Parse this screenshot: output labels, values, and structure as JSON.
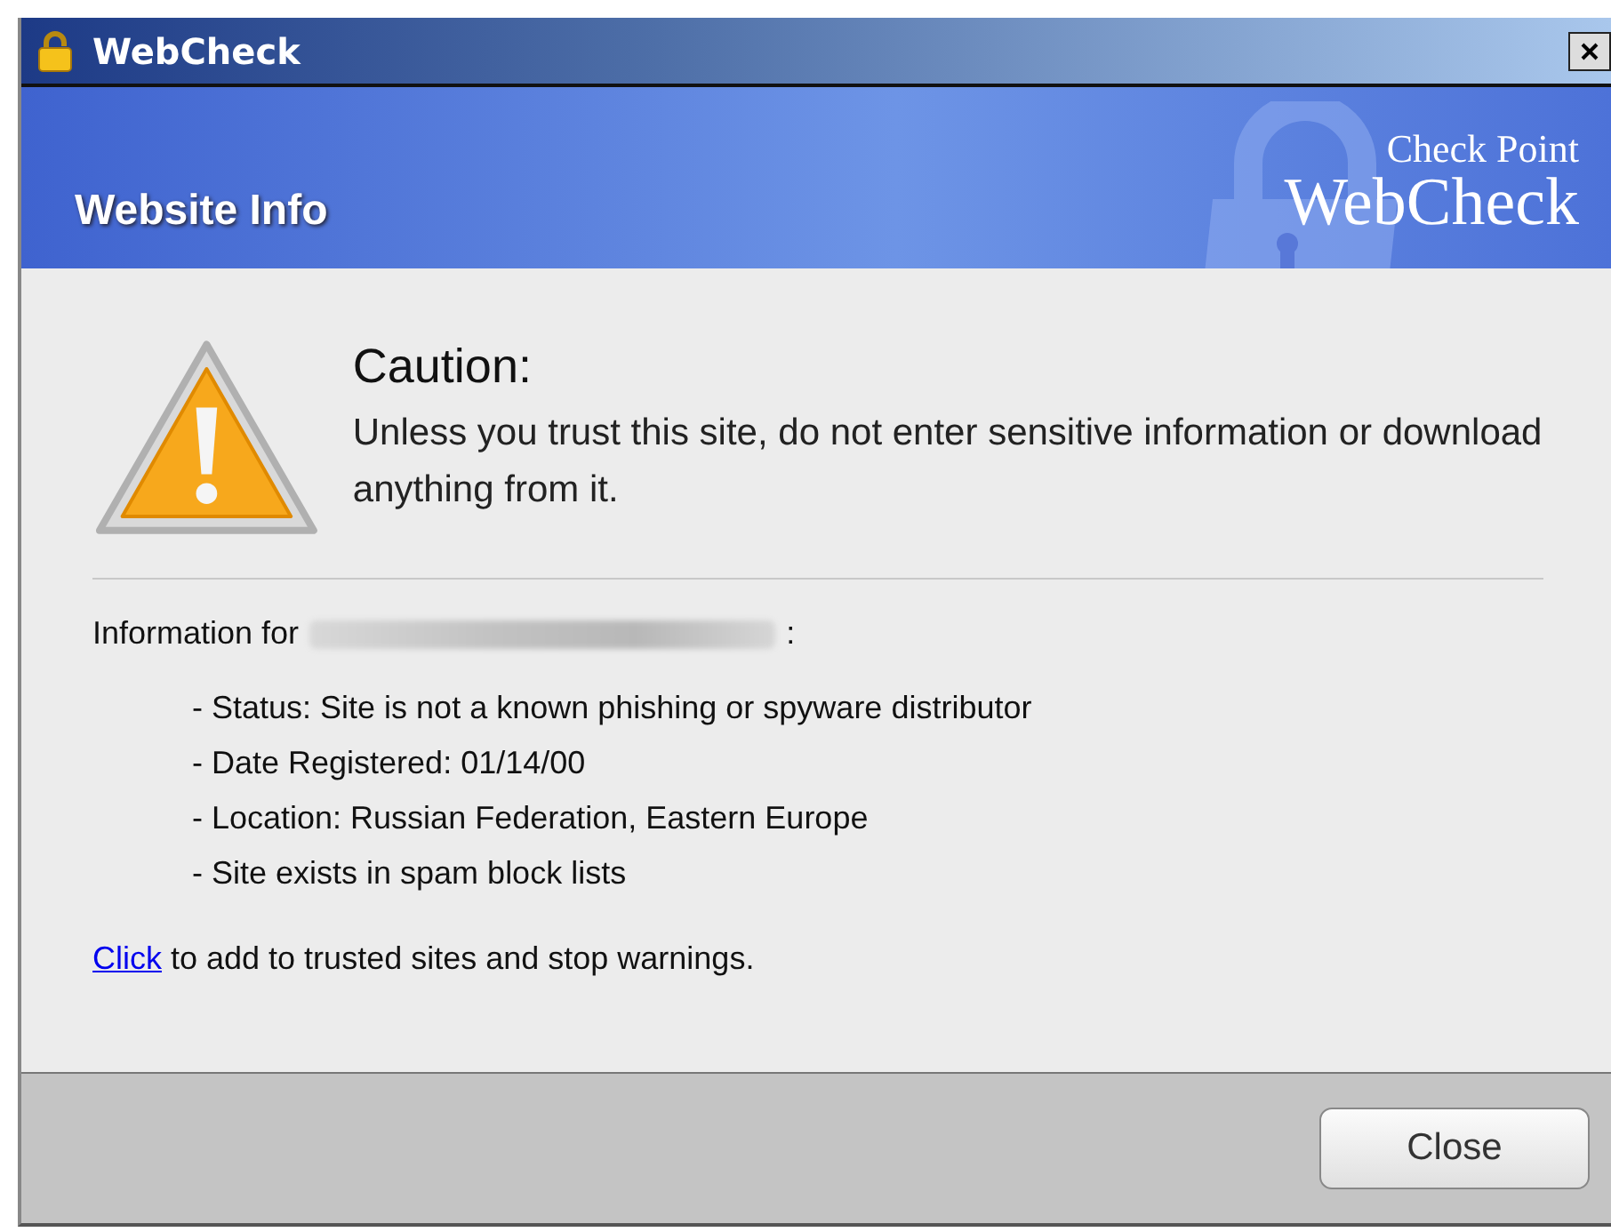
{
  "window": {
    "title": "WebCheck"
  },
  "banner": {
    "title": "Website Info",
    "logo_top": "Check Point",
    "logo_main": "WebCheck"
  },
  "caution": {
    "heading": "Caution:",
    "message": "Unless you trust this site, do not enter sensitive information or download anything from it."
  },
  "info": {
    "label": "Information for",
    "suffix": ":",
    "items": [
      "- Status: Site is not a known phishing or spyware distributor",
      "- Date Registered: 01/14/00",
      "- Location: Russian Federation, Eastern Europe",
      "- Site exists in spam block lists"
    ]
  },
  "trust": {
    "link": "Click",
    "text": " to add to trusted sites and stop warnings."
  },
  "buttons": [
    "Close"
  ]
}
